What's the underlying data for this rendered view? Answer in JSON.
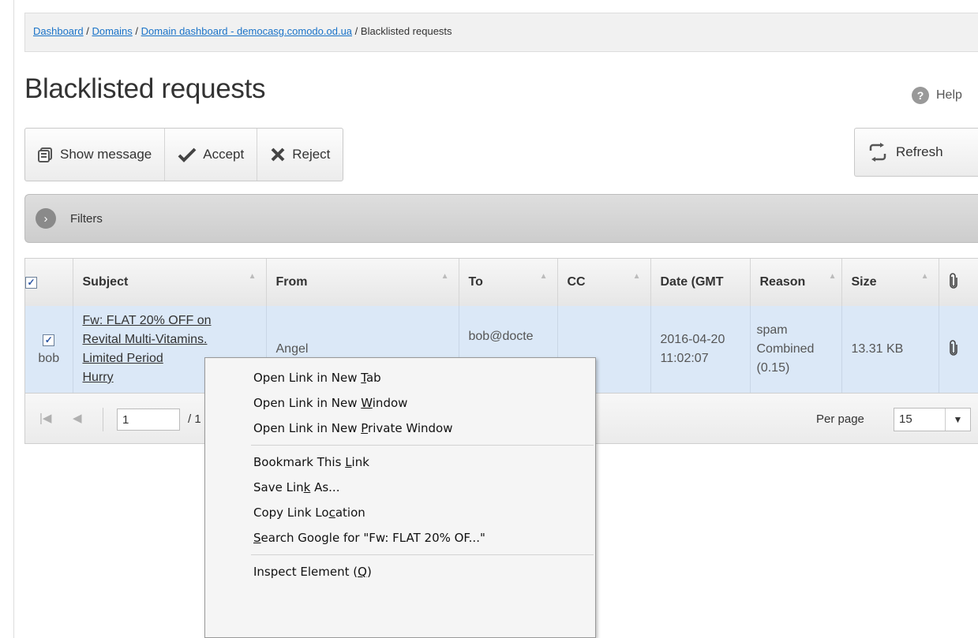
{
  "breadcrumb": {
    "items": [
      {
        "label": "Dashboard",
        "link": true
      },
      {
        "label": "Domains",
        "link": true
      },
      {
        "label": "Domain dashboard - democasg.comodo.od.ua",
        "link": true
      },
      {
        "label": "Blacklisted requests",
        "link": false
      }
    ],
    "separator": "/"
  },
  "page": {
    "title": "Blacklisted requests",
    "help_label": "Help"
  },
  "toolbar": {
    "show_message": "Show message",
    "accept": "Accept",
    "reject": "Reject",
    "refresh": "Refresh"
  },
  "filters": {
    "label": "Filters"
  },
  "grid": {
    "columns": [
      "Subject",
      "From",
      "To",
      "CC",
      "Date (GMT",
      "Reason",
      "Size"
    ],
    "rows": [
      {
        "checked": true,
        "user": "bob",
        "subject_lines": [
          "Fw: FLAT 20% OFF on",
          "Revital Multi-Vitamins.",
          "Limited Period",
          "Hurry"
        ],
        "from": "Angel",
        "to": "bob@docte",
        "cc": "",
        "date_line1": "2016-04-20",
        "date_line2": "11:02:07",
        "reason_lines": [
          "spam",
          "Combined",
          "(0.15)"
        ],
        "size": "13.31 KB"
      }
    ]
  },
  "pager": {
    "page_value": "1",
    "of_text": "/ 1",
    "per_page_label": "Per page",
    "per_page_value": "15"
  },
  "context_menu": {
    "items": [
      {
        "pre": "Open Link in New ",
        "key": "T",
        "post": "ab"
      },
      {
        "pre": "Open Link in New ",
        "key": "W",
        "post": "indow"
      },
      {
        "pre": "Open Link in New ",
        "key": "P",
        "post": "rivate Window"
      },
      {
        "pre": "Bookmark This ",
        "key": "L",
        "post": "ink"
      },
      {
        "pre": "Save Lin",
        "key": "k",
        "post": " As..."
      },
      {
        "pre": "Copy Link Lo",
        "key": "c",
        "post": "ation"
      },
      {
        "pre": "",
        "key": "S",
        "post": "earch Google for \"Fw: FLAT 20% OF...\""
      },
      {
        "pre": "Inspect Element (",
        "key": "Q",
        "post": ")"
      }
    ]
  },
  "colors": {
    "link": "#1a73c8",
    "row_selected": "#dbe8f7",
    "filter_bar": "#cdcdcd"
  }
}
